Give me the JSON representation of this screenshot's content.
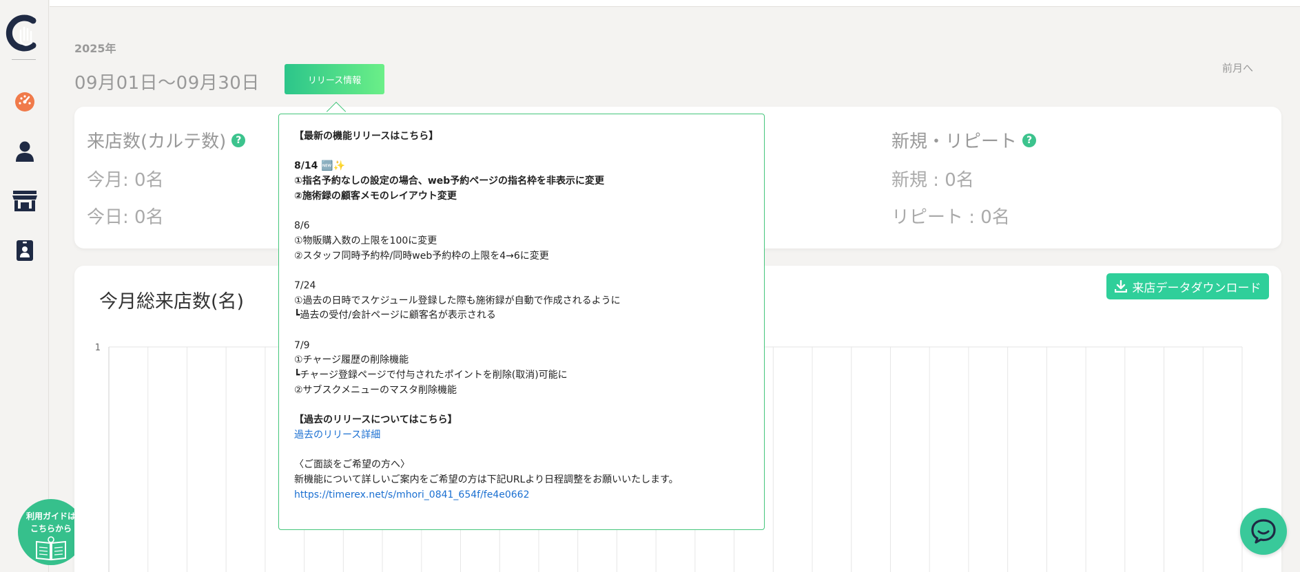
{
  "sidebar": {
    "logo": "app-logo-hand",
    "items": [
      {
        "name": "dashboard-icon",
        "color": "#f07a4a"
      },
      {
        "name": "customer-icon",
        "color": "#1f2a44"
      },
      {
        "name": "store-icon",
        "color": "#1f2a44"
      },
      {
        "name": "staff-card-icon",
        "color": "#1f2a44"
      }
    ],
    "guide_line1": "利用ガイドは",
    "guide_line2": "こちらから"
  },
  "header": {
    "year": "2025年",
    "range": "09月01日〜09月30日",
    "release_button": "リリース情報",
    "prev_month": "前月へ"
  },
  "stats": {
    "visits_title": "来店数(カルテ数)",
    "visits_month": "今月: 0名",
    "visits_today": "今日: 0名",
    "newrepeat_title": "新規・リピート",
    "new_count": "新規 : 0名",
    "repeat_count": "リピート : 0名"
  },
  "chart": {
    "title": "今月総来店数(名)",
    "download_label": "来店データダウンロード"
  },
  "chart_data": {
    "type": "bar",
    "title": "今月総来店数(名)",
    "ylim": [
      0,
      1
    ],
    "ytick_labels": [
      "1"
    ],
    "grid": true,
    "categories_count": 29,
    "values": []
  },
  "popup": {
    "heading": "【最新の機能リリースはこちら】",
    "r1_date": "8/14 🆕✨",
    "r1_l1": "①指名予約なしの設定の場合、web予約ページの指名枠を非表示に変更",
    "r1_l2": "②施術録の顧客メモのレイアウト変更",
    "r2_date": "8/6",
    "r2_l1": "①物販購入数の上限を100に変更",
    "r2_l2": "②スタッフ同時予約枠/同時web予約枠の上限を4→6に変更",
    "r3_date": "7/24",
    "r3_l1": "①過去の日時でスケジュール登録した際も施術録が自動で作成されるように",
    "r3_l2": "┗過去の受付/会計ページに顧客名が表示される",
    "r4_date": "7/9",
    "r4_l1": "①チャージ履歴の削除機能",
    "r4_l2": "┗チャージ登録ページで付与されたポイントを削除(取消)可能に",
    "r4_l3": "②サブスクメニューのマスタ削除機能",
    "past_heading": "【過去のリリースについてはこちら】",
    "past_link": "過去のリリース詳細",
    "consult_heading": "〈ご面談をご希望の方へ〉",
    "consult_text": "新機能について詳しいご案内をご希望の方は下記URLより日程調整をお願いいたします。",
    "consult_link": "https://timerex.net/s/mhori_0841_654f/fe4e0662"
  }
}
